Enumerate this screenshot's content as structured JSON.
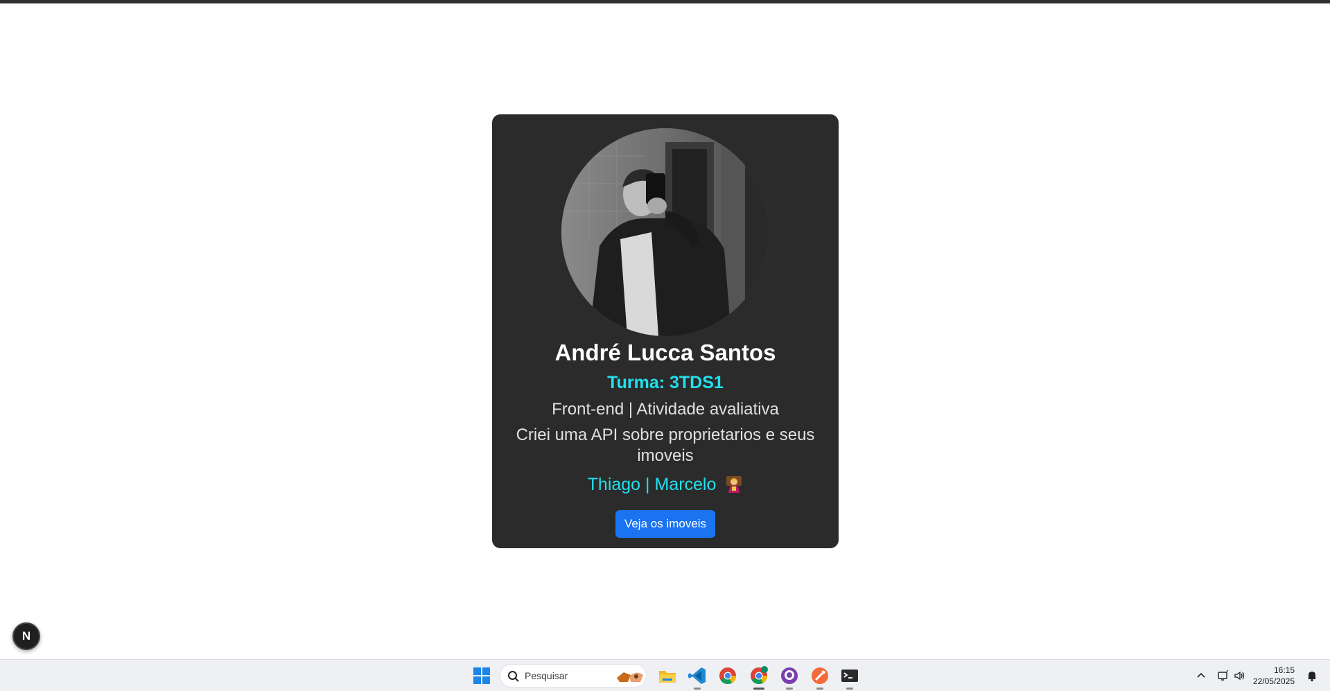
{
  "profile": {
    "name": "André Lucca Santos",
    "turma": "Turma: 3TDS1",
    "role": "Front-end | Atividade avaliativa",
    "description": "Criei uma API sobre proprietarios e seus imoveis",
    "teachers": "Thiago | Marcelo",
    "teachers_emoji": "teacher-emoji-icon",
    "button_label": "Veja os imoveis"
  },
  "dev_badge": {
    "label": "N"
  },
  "taskbar": {
    "search_placeholder": "Pesquisar",
    "apps": [
      "start-icon",
      "search",
      "file-explorer-icon",
      "vscode-icon",
      "chrome-icon",
      "chrome-profile-icon",
      "github-desktop-icon",
      "postman-icon",
      "terminal-icon"
    ],
    "time": "16:15",
    "date": "22/05/2025"
  },
  "colors": {
    "card_bg": "#2b2b2b",
    "accent_cyan": "#22e0ee",
    "button_blue": "#1a73f0",
    "taskbar_bg": "#eef0f4"
  }
}
